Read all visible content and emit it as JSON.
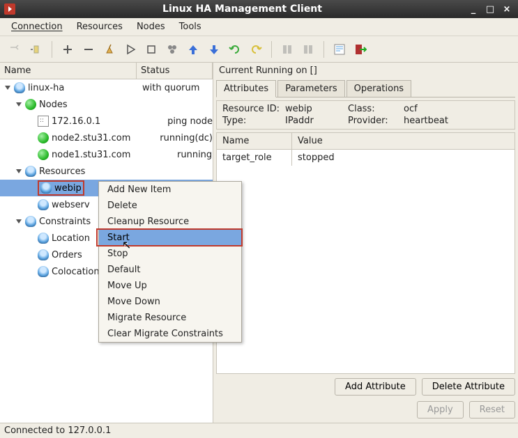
{
  "window": {
    "title": "Linux HA Management Client",
    "min": "_",
    "max": "□",
    "close": "×"
  },
  "menubar": [
    "Connection",
    "Resources",
    "Nodes",
    "Tools"
  ],
  "tree": {
    "headers": {
      "name": "Name",
      "status": "Status"
    },
    "root": {
      "label": "linux-ha",
      "status": "with quorum"
    },
    "nodes_group": {
      "label": "Nodes",
      "status": ""
    },
    "nodes": [
      {
        "label": "172.16.0.1",
        "status": "ping node"
      },
      {
        "label": "node2.stu31.com",
        "status": "running(dc)"
      },
      {
        "label": "node1.stu31.com",
        "status": "running"
      }
    ],
    "resources_group": {
      "label": "Resources",
      "status": ""
    },
    "resources": [
      {
        "label": "webip",
        "status": ""
      },
      {
        "label": "webserv",
        "status": ""
      }
    ],
    "constraints_group": {
      "label": "Constraints",
      "status": ""
    },
    "constraints": [
      {
        "label": "Location",
        "status": ""
      },
      {
        "label": "Orders",
        "status": ""
      },
      {
        "label": "Colocation",
        "status": ""
      }
    ]
  },
  "context_menu": {
    "items": [
      "Add New Item",
      "Delete",
      "Cleanup Resource",
      "Start",
      "Stop",
      "Default",
      "Move Up",
      "Move Down",
      "Migrate Resource",
      "Clear Migrate Constraints"
    ],
    "highlighted_index": 3
  },
  "right": {
    "running_on": "Current Running on []",
    "tabs": [
      "Attributes",
      "Parameters",
      "Operations"
    ],
    "active_tab": 0,
    "info": {
      "resource_id_label": "Resource ID:",
      "resource_id": "webip",
      "class_label": "Class:",
      "class": "ocf",
      "type_label": "Type:",
      "type": "IPaddr",
      "provider_label": "Provider:",
      "provider": "heartbeat"
    },
    "attr_headers": {
      "name": "Name",
      "value": "Value"
    },
    "attrs": [
      {
        "name": "target_role",
        "value": "stopped"
      }
    ],
    "buttons": {
      "add": "Add Attribute",
      "del": "Delete Attribute",
      "apply": "Apply",
      "reset": "Reset"
    }
  },
  "statusbar": "Connected to 127.0.0.1"
}
